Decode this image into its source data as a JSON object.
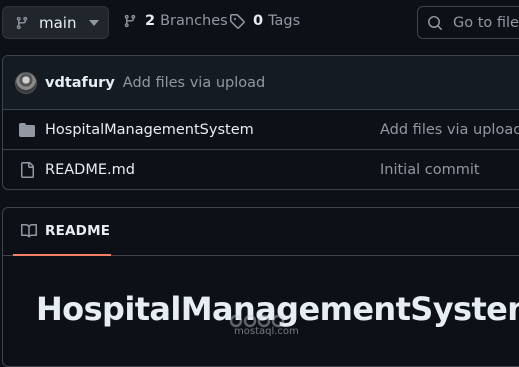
{
  "toolbar": {
    "branch": "main",
    "branches_count": "2",
    "branches_label": "Branches",
    "tags_count": "0",
    "tags_label": "Tags",
    "goto_placeholder": "Go to file"
  },
  "latest_commit": {
    "user": "vdtafury",
    "message": "Add files via upload"
  },
  "files": [
    {
      "type": "folder",
      "name": "HospitalManagementSystem",
      "commit": "Add files via upload"
    },
    {
      "type": "file",
      "name": "README.md",
      "commit": "Initial commit"
    }
  ],
  "readme": {
    "tab_label": "README",
    "heading": "HospitalManagementSystem"
  },
  "watermark": {
    "text": "mostaql.com"
  },
  "colors": {
    "background": "#0d1117",
    "border": "#3d444d",
    "muted_text": "#9198a1",
    "tab_underline": "#f78166"
  }
}
